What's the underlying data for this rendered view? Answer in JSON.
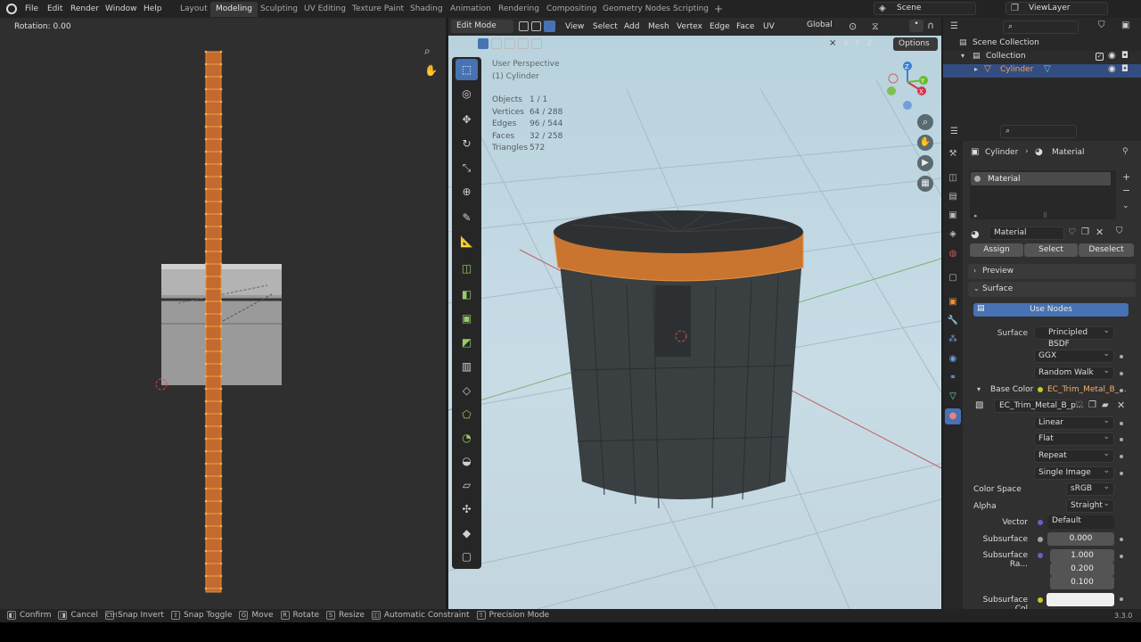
{
  "top_menu": [
    "File",
    "Edit",
    "Render",
    "Window",
    "Help"
  ],
  "workspaces": [
    "Layout",
    "Modeling",
    "Sculpting",
    "UV Editing",
    "Texture Paint",
    "Shading",
    "Animation",
    "Rendering",
    "Compositing",
    "Geometry Nodes",
    "Scripting"
  ],
  "active_workspace": "Modeling",
  "scene_name": "Scene",
  "view_layer": "ViewLayer",
  "uv": {
    "operator_text": "Rotation: 0.00"
  },
  "viewport": {
    "mode": "Edit Mode",
    "menus": [
      "View",
      "Select",
      "Add",
      "Mesh",
      "Vertex",
      "Edge",
      "Face",
      "UV"
    ],
    "orientation": "Global",
    "options_label": "Options",
    "axes": [
      "X",
      "Y",
      "Z"
    ],
    "view_name": "User Perspective",
    "object_name": "(1) Cylinder",
    "stats": [
      {
        "label": "Objects",
        "value": "1 / 1"
      },
      {
        "label": "Vertices",
        "value": "64 / 288"
      },
      {
        "label": "Edges",
        "value": "96 / 544"
      },
      {
        "label": "Faces",
        "value": "32 / 258"
      },
      {
        "label": "Triangles",
        "value": "572"
      }
    ]
  },
  "outliner": {
    "scene_collection": "Scene Collection",
    "collection": "Collection",
    "object": "Cylinder"
  },
  "properties": {
    "breadcrumb_object": "Cylinder",
    "breadcrumb_material": "Material",
    "slot_name": "Material",
    "material_name": "Material",
    "assign": "Assign",
    "select": "Select",
    "deselect": "Deselect",
    "preview": "Preview",
    "surface_panel": "Surface",
    "use_nodes": "Use Nodes",
    "surface_label": "Surface",
    "surface_value": "Principled BSDF",
    "distribution": "GGX",
    "subsurface_method": "Random Walk",
    "base_color_label": "Base Color",
    "base_color_value": "EC_Trim_Metal_B_...",
    "image_name": "EC_Trim_Metal_B_p...",
    "interpolation": "Linear",
    "projection": "Flat",
    "extension": "Repeat",
    "source": "Single Image",
    "color_space_label": "Color Space",
    "color_space": "sRGB",
    "alpha_label": "Alpha",
    "alpha": "Straight",
    "vector_label": "Vector",
    "vector": "Default",
    "subsurface_label": "Subsurface",
    "subsurface": "0.000",
    "subsurface_radius_label": "Subsurface Ra...",
    "radius": [
      "1.000",
      "0.200",
      "0.100"
    ],
    "subsurface_color_label": "Subsurface Col"
  },
  "statusbar": [
    {
      "key": "◧",
      "text": "Confirm"
    },
    {
      "key": "◨",
      "text": "Cancel"
    },
    {
      "key": "Ctrl",
      "text": "Snap Invert"
    },
    {
      "key": "⇧",
      "text": "Snap Toggle"
    },
    {
      "key": "G",
      "text": "Move"
    },
    {
      "key": "R",
      "text": "Rotate"
    },
    {
      "key": "S",
      "text": "Resize"
    },
    {
      "key": "◫",
      "text": "Automatic Constraint"
    },
    {
      "key": "⇧",
      "text": "Precision Mode"
    }
  ],
  "version": "3.3.0"
}
